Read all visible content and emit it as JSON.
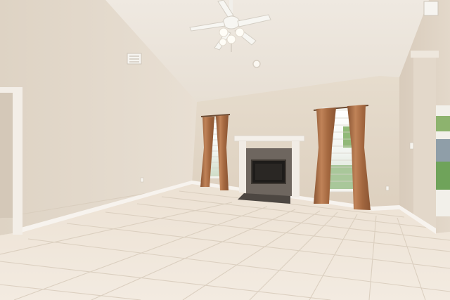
{
  "scene": {
    "description_tags": [
      "empty-living-room",
      "vaulted-ceiling",
      "fireplace",
      "ceiling-fan",
      "tile-floor"
    ],
    "colors": {
      "ceiling": "#ede7df",
      "left_wall": "#e6dccf",
      "back_wall": "#e2d6c6",
      "right_wall": "#ddd1c1",
      "floor": "#efe6da",
      "grout": "#d9cdbd",
      "baseboard": "#f7f3ee",
      "mantel": "#f4f0ea",
      "firebox_surround": "#6e665f",
      "firebox": "#1e1c1a",
      "hearth": "#4d4742",
      "curtain": "#b7774a",
      "curtain_shadow": "#8a5533",
      "window_light": "#f6f8f6",
      "outside_green": "#6fa35a",
      "fan_white": "#f7f6f2"
    }
  }
}
